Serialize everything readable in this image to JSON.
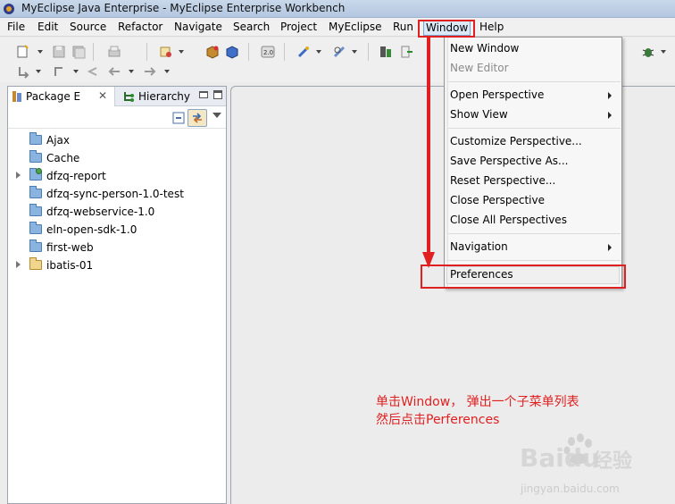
{
  "window": {
    "title": "MyEclipse Java Enterprise - MyEclipse Enterprise Workbench"
  },
  "menubar": {
    "items": [
      "File",
      "Edit",
      "Source",
      "Refactor",
      "Navigate",
      "Search",
      "Project",
      "MyEclipse",
      "Run",
      "Window",
      "Help"
    ]
  },
  "left_view": {
    "tabs": [
      {
        "label": "Package E",
        "close_glyph": "✕"
      },
      {
        "label": "Hierarchy"
      }
    ],
    "tree": [
      {
        "label": "Ajax",
        "expandable": false,
        "icon": "folder-icon"
      },
      {
        "label": "Cache",
        "expandable": false,
        "icon": "folder-icon"
      },
      {
        "label": "dfzq-report",
        "expandable": true,
        "icon": "web-project-icon"
      },
      {
        "label": "dfzq-sync-person-1.0-test",
        "expandable": false,
        "icon": "folder-icon"
      },
      {
        "label": "dfzq-webservice-1.0",
        "expandable": false,
        "icon": "folder-icon"
      },
      {
        "label": "eln-open-sdk-1.0",
        "expandable": false,
        "icon": "folder-icon"
      },
      {
        "label": "first-web",
        "expandable": false,
        "icon": "folder-icon"
      },
      {
        "label": "ibatis-01",
        "expandable": true,
        "icon": "open-folder-icon"
      }
    ]
  },
  "window_menu": {
    "items": [
      {
        "label": "New Window",
        "enabled": true,
        "submenu": false
      },
      {
        "label": "New Editor",
        "enabled": false,
        "submenu": false
      },
      {
        "label": "Open Perspective",
        "enabled": true,
        "submenu": true
      },
      {
        "label": "Show View",
        "enabled": true,
        "submenu": true
      },
      {
        "label": "Customize Perspective...",
        "enabled": true,
        "submenu": false
      },
      {
        "label": "Save Perspective As...",
        "enabled": true,
        "submenu": false
      },
      {
        "label": "Reset Perspective...",
        "enabled": true,
        "submenu": false
      },
      {
        "label": "Close Perspective",
        "enabled": true,
        "submenu": false
      },
      {
        "label": "Close All Perspectives",
        "enabled": true,
        "submenu": false
      },
      {
        "label": "Navigation",
        "enabled": true,
        "submenu": true
      },
      {
        "label": "Preferences",
        "enabled": true,
        "submenu": false
      }
    ]
  },
  "annotation": {
    "line1": "单击Window， 弹出一个子菜单列表",
    "line2": "然后点击Perferences",
    "color": "#e02020"
  },
  "watermark": {
    "brand": "Baidu",
    "jingyan": "经验",
    "url": "jingyan.baidu.com"
  }
}
